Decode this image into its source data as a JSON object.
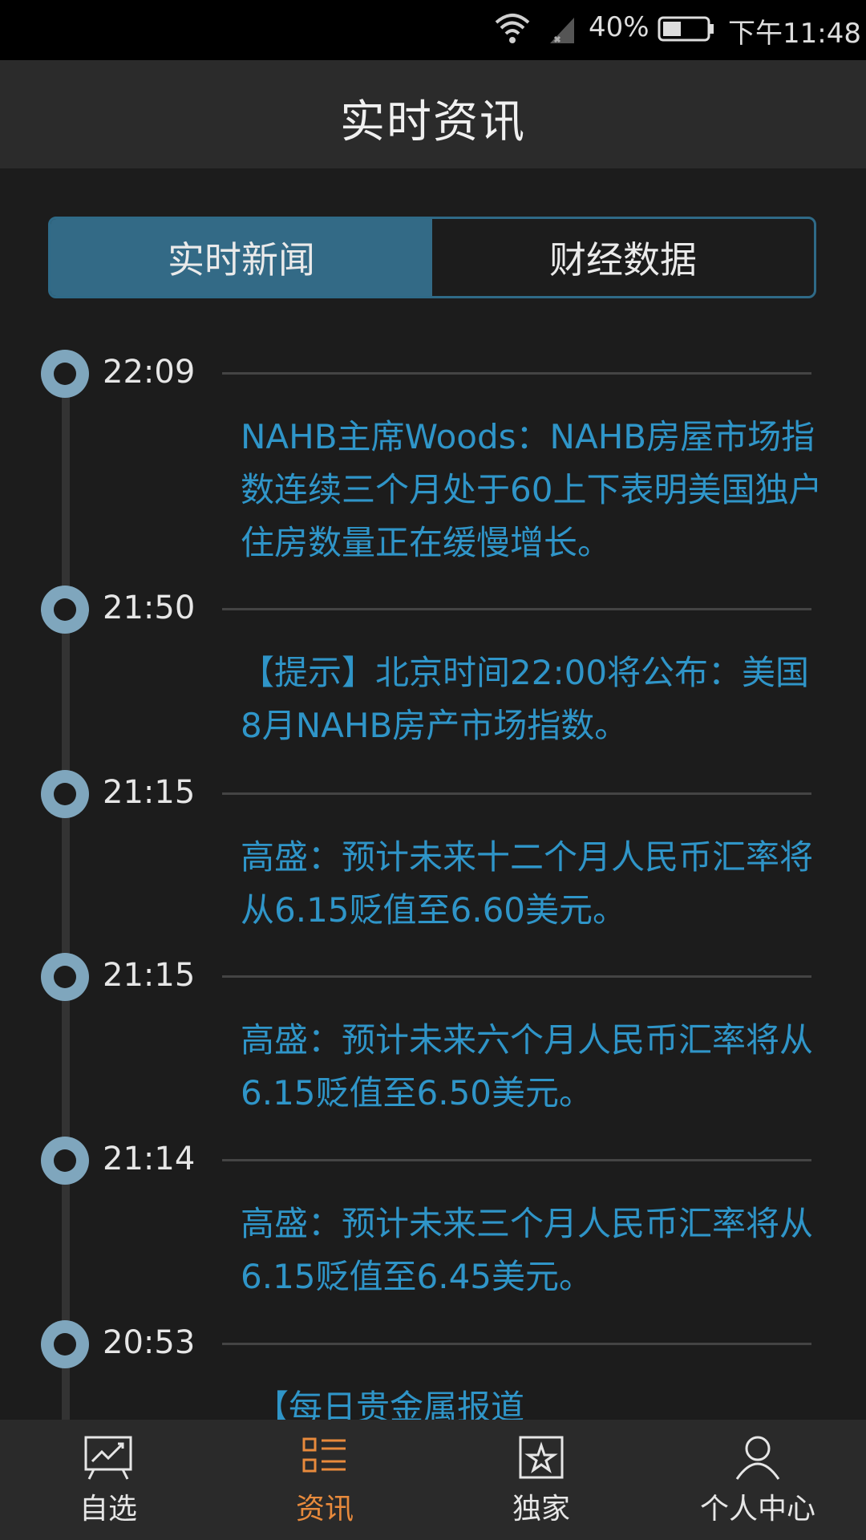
{
  "status_bar": {
    "battery_percent": "40%",
    "clock": "下午11:48",
    "wifi_icon": "wifi-icon",
    "signal_icon": "signal-icon",
    "battery_icon": "battery-icon"
  },
  "header": {
    "title": "实时资讯"
  },
  "tabs": [
    {
      "label": "实时新闻",
      "active": true
    },
    {
      "label": "财经数据",
      "active": false
    }
  ],
  "news": [
    {
      "time": "22:09",
      "text": "NAHB主席Woods：NAHB房屋市场指数连续三个月处于60上下表明美国独户住房数量正在缓慢增长。"
    },
    {
      "time": "21:50",
      "text": "【提示】北京时间22:00将公布：美国8月NAHB房产市场指数。"
    },
    {
      "time": "21:15",
      "text": "高盛：预计未来十二个月人民币汇率将从6.15贬值至6.60美元。"
    },
    {
      "time": "21:15",
      "text": "高盛：预计未来六个月人民币汇率将从6.15贬值至6.50美元。"
    },
    {
      "time": "21:14",
      "text": "高盛：预计未来三个月人民币汇率将从6.15贬值至6.45美元。"
    },
    {
      "time": "20:53",
      "text": "【每日贵金属报道"
    }
  ],
  "bottom_nav": [
    {
      "label": "自选",
      "icon": "chart-board-icon",
      "active": false
    },
    {
      "label": "资讯",
      "icon": "list-icon",
      "active": true
    },
    {
      "label": "独家",
      "icon": "star-image-icon",
      "active": false
    },
    {
      "label": "个人中心",
      "icon": "person-icon",
      "active": false
    }
  ],
  "colors": {
    "accent_blue": "#336a86",
    "news_text": "#2f95c8",
    "active_nav": "#e88a3c"
  }
}
